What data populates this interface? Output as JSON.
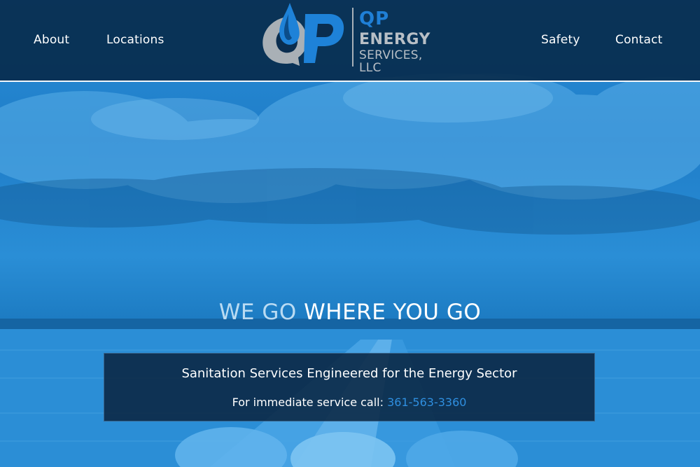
{
  "nav": {
    "left": [
      {
        "label": "About"
      },
      {
        "label": "Locations"
      }
    ],
    "right": [
      {
        "label": "Safety"
      },
      {
        "label": "Contact"
      }
    ]
  },
  "logo": {
    "line1": "QP",
    "line2": "ENERGY",
    "line3": "SERVICES, LLC",
    "icon": "qp-drop-logo-icon"
  },
  "hero": {
    "headline_light": "WE GO",
    "headline_strong": "WHERE YOU GO",
    "tagline": "Sanitation Services Engineered for the Energy Sector",
    "call_label": "For immediate service call:",
    "phone": "361-563-3360",
    "background": "pipeline-field-sky-image"
  },
  "colors": {
    "header_bg": "#082c4e",
    "accent": "#2f8fe0",
    "overlay_blue": "#1f7dc8",
    "logo_gray": "#b8bfc6"
  }
}
